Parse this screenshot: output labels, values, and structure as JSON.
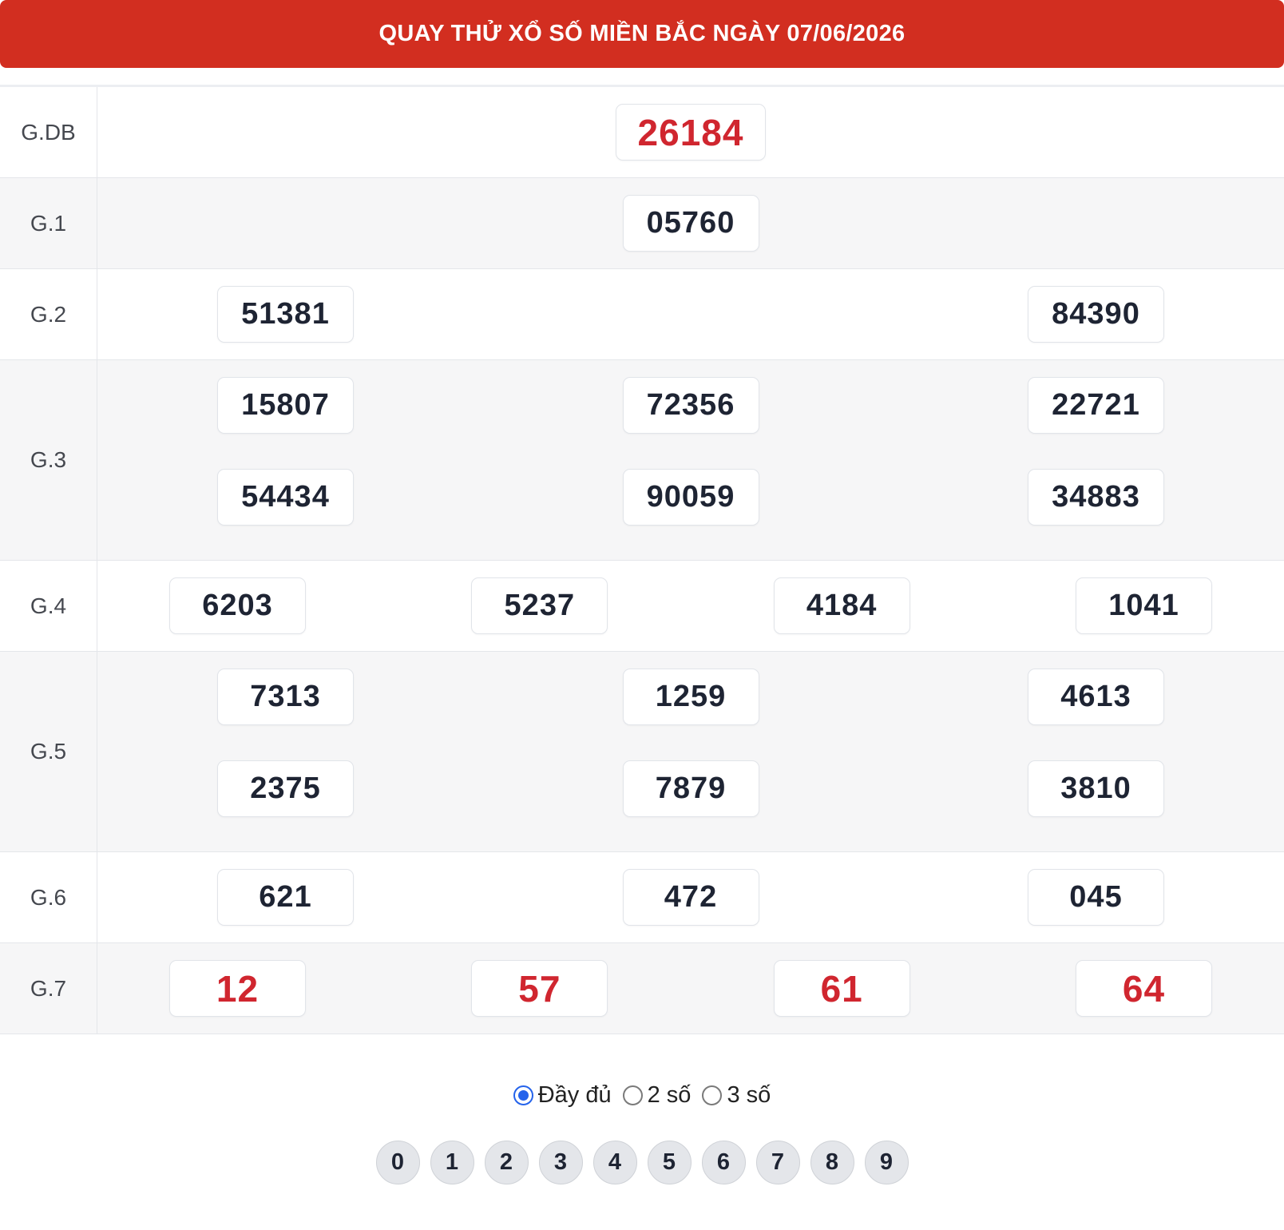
{
  "header": {
    "title": "QUAY THỬ XỔ SỐ MIỀN BẮC NGÀY 07/06/2026"
  },
  "prizes": [
    {
      "label": "G.DB",
      "numbers": [
        "26184"
      ]
    },
    {
      "label": "G.1",
      "numbers": [
        "05760"
      ]
    },
    {
      "label": "G.2",
      "numbers": [
        "51381",
        "84390"
      ]
    },
    {
      "label": "G.3",
      "numbers": [
        "15807",
        "72356",
        "22721",
        "54434",
        "90059",
        "34883"
      ]
    },
    {
      "label": "G.4",
      "numbers": [
        "6203",
        "5237",
        "4184",
        "1041"
      ]
    },
    {
      "label": "G.5",
      "numbers": [
        "7313",
        "1259",
        "4613",
        "2375",
        "7879",
        "3810"
      ]
    },
    {
      "label": "G.6",
      "numbers": [
        "621",
        "472",
        "045"
      ]
    },
    {
      "label": "G.7",
      "numbers": [
        "12",
        "57",
        "61",
        "64"
      ]
    }
  ],
  "display_options": [
    {
      "label": "Đầy đủ",
      "checked": true
    },
    {
      "label": "2 số",
      "checked": false
    },
    {
      "label": "3 số",
      "checked": false
    }
  ],
  "digit_filters": [
    "0",
    "1",
    "2",
    "3",
    "4",
    "5",
    "6",
    "7",
    "8",
    "9"
  ],
  "colors": {
    "header_bg": "#d22e20",
    "special_number": "#d0262f",
    "radio_accent": "#2563eb"
  }
}
